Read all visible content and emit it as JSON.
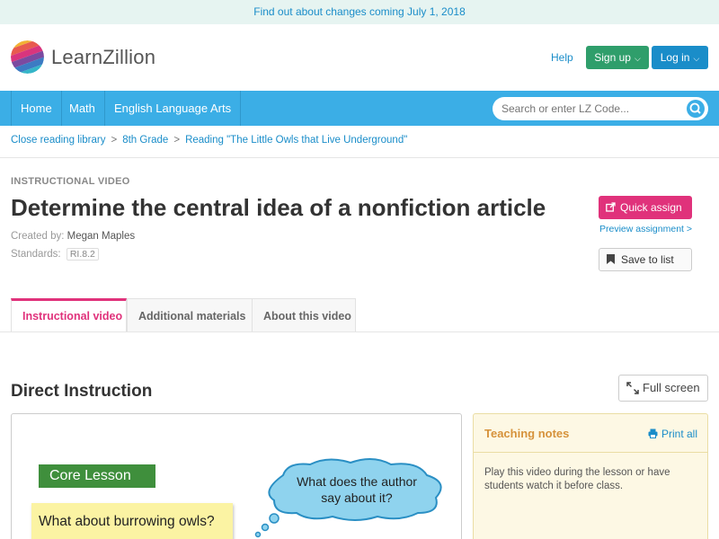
{
  "announcement": "Find out about changes coming July 1, 2018",
  "brand": {
    "name": "LearnZillion",
    "logo_icon": "striped-sphere-logo"
  },
  "header": {
    "help": "Help",
    "signup": "Sign up",
    "login": "Log in"
  },
  "nav": {
    "items": [
      "Home",
      "Math",
      "English Language Arts"
    ],
    "search_placeholder": "Search or enter LZ Code..."
  },
  "breadcrumb": [
    "Close reading library",
    "8th Grade",
    "Reading \"The Little Owls that Live Underground\""
  ],
  "lesson": {
    "eyebrow": "INSTRUCTIONAL VIDEO",
    "title": "Determine the central idea of a nonfiction article",
    "created_by_label": "Created by:",
    "created_by": "Megan Maples",
    "standards_label": "Standards:",
    "standard": "RI.8.2"
  },
  "actions": {
    "quick_assign": "Quick assign",
    "preview": "Preview assignment >",
    "save": "Save to list"
  },
  "tabs": [
    "Instructional video",
    "Additional materials",
    "About this video"
  ],
  "section": {
    "title": "Direct Instruction",
    "fullscreen": "Full screen"
  },
  "video": {
    "core_lesson": "Core Lesson",
    "question": "What about burrowing owls?",
    "bubble_line1": "What does the author",
    "bubble_line2": "say about it?"
  },
  "teaching_notes": {
    "title": "Teaching notes",
    "print": "Print all",
    "body": "Play this video during the lesson or have students watch it before class."
  },
  "colors": {
    "accent_pink": "#e0327b",
    "nav_blue": "#3baee6",
    "link_blue": "#1a8dc9",
    "signup_green": "#2f9e6b"
  }
}
